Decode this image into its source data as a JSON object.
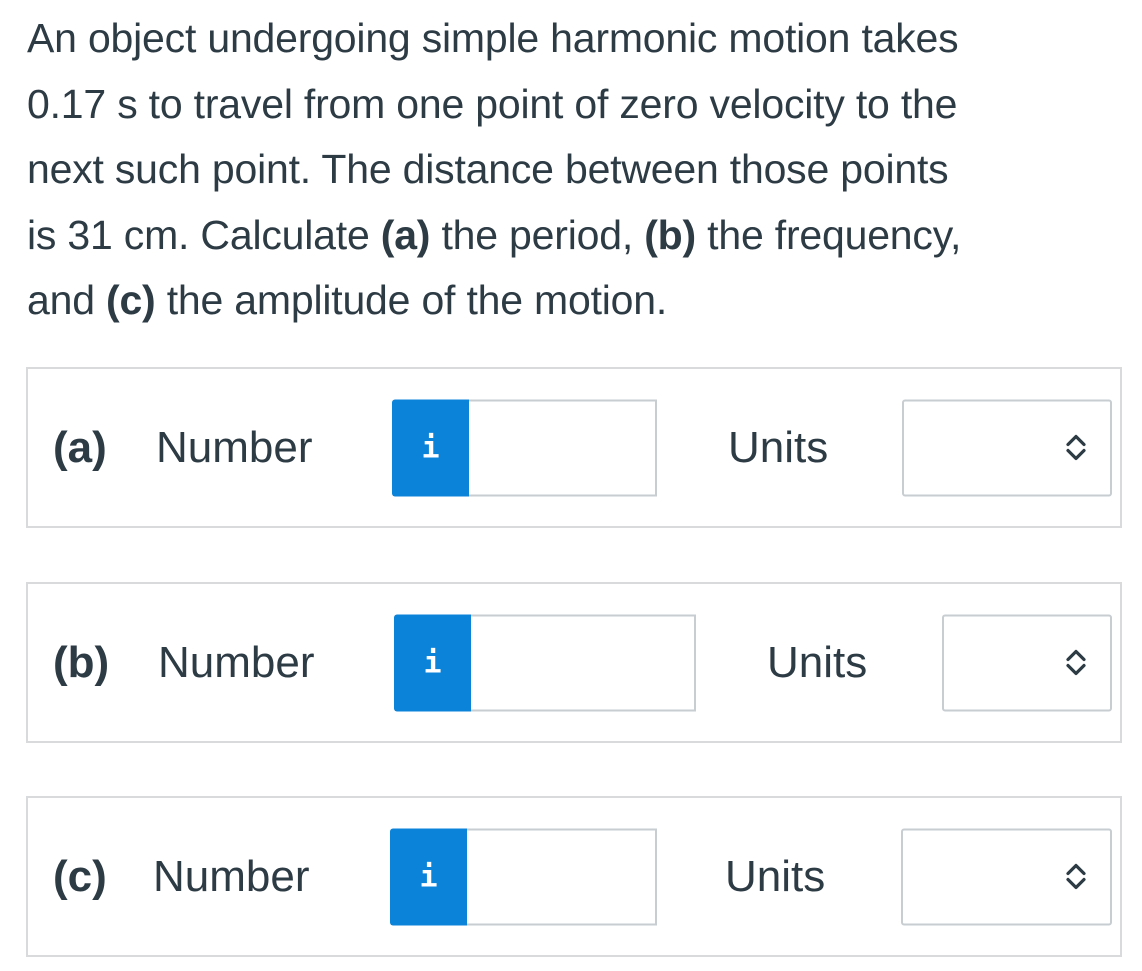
{
  "question": {
    "line1": "An object undergoing simple harmonic motion takes",
    "line2": "0.17 s to travel from one point of zero velocity to the",
    "line3": "next such point. The distance between those points",
    "line4_pre": "is 31 cm. Calculate ",
    "line4_a": "(a)",
    "line4_mid1": " the period, ",
    "line4_b": "(b)",
    "line4_mid2": " the frequency,",
    "line5_pre": "and ",
    "line5_c": "(c)",
    "line5_post": " the amplitude of the motion."
  },
  "parts": [
    {
      "label": "(a)",
      "number_label": "Number",
      "info_glyph": "i",
      "number_value": "",
      "units_label": "Units",
      "units_value": ""
    },
    {
      "label": "(b)",
      "number_label": "Number",
      "info_glyph": "i",
      "number_value": "",
      "units_label": "Units",
      "units_value": ""
    },
    {
      "label": "(c)",
      "number_label": "Number",
      "info_glyph": "i",
      "number_value": "",
      "units_label": "Units",
      "units_value": ""
    }
  ],
  "icons": {
    "info": "info-icon",
    "select_arrows": "chevron-up-down-icon"
  },
  "colors": {
    "accent": "#0b83d9",
    "text": "#2d3b45",
    "border": "#d8dadc"
  }
}
